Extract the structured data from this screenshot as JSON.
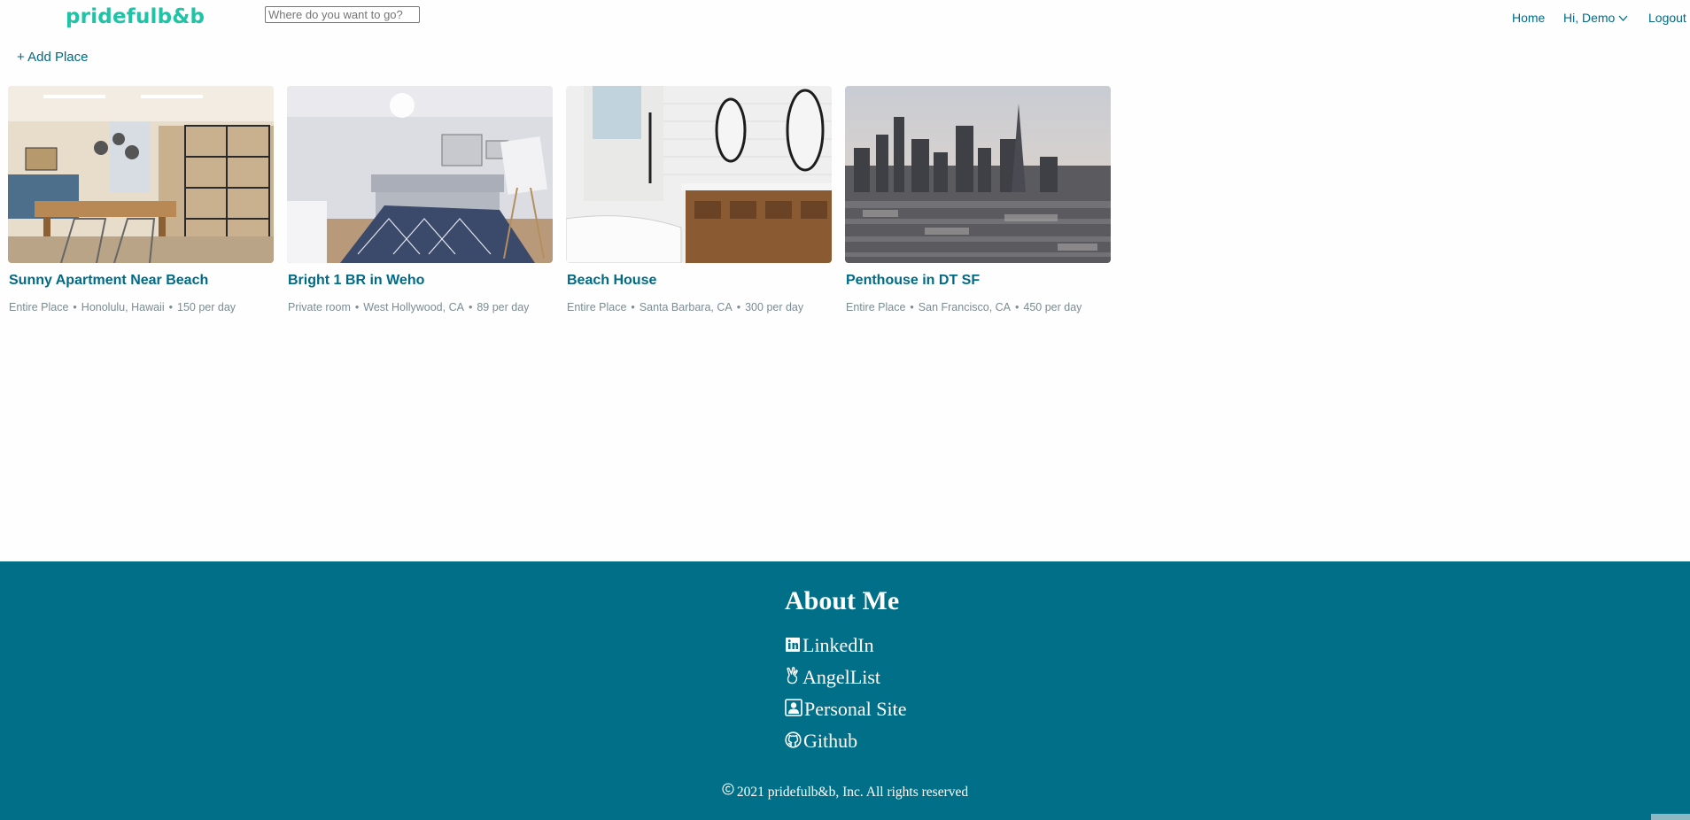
{
  "header": {
    "logo": "pridefulb&b",
    "search_placeholder": "Where do you want to go?",
    "nav": {
      "home": "Home",
      "user": "Hi, Demo",
      "logout": "Logout"
    }
  },
  "actions": {
    "add_place": "+ Add Place"
  },
  "listings": [
    {
      "title": "Sunny Apartment Near Beach",
      "type": "Entire Place",
      "location": "Honolulu, Hawaii",
      "price": "150 per day"
    },
    {
      "title": "Bright 1 BR in Weho",
      "type": "Private room",
      "location": "West Hollywood, CA",
      "price": "89 per day"
    },
    {
      "title": "Beach House",
      "type": "Entire Place",
      "location": "Santa Barbara, CA",
      "price": "300 per day"
    },
    {
      "title": "Penthouse in DT SF",
      "type": "Entire Place",
      "location": "San Francisco, CA",
      "price": "450 per day"
    }
  ],
  "footer": {
    "heading": "About Me",
    "links": [
      "LinkedIn",
      "AngelList",
      "Personal Site",
      "Github"
    ],
    "copyright": "2021 pridefulb&b, Inc. All rights reserved"
  },
  "colors": {
    "brand": "#1fc3a6",
    "primary": "#006b86",
    "footer_bg": "#006f87",
    "muted": "#7b8c93"
  },
  "icons": [
    "chevron-down-icon",
    "linkedin-icon",
    "angellist-icon",
    "personal-site-icon",
    "github-icon",
    "copyright-icon"
  ]
}
